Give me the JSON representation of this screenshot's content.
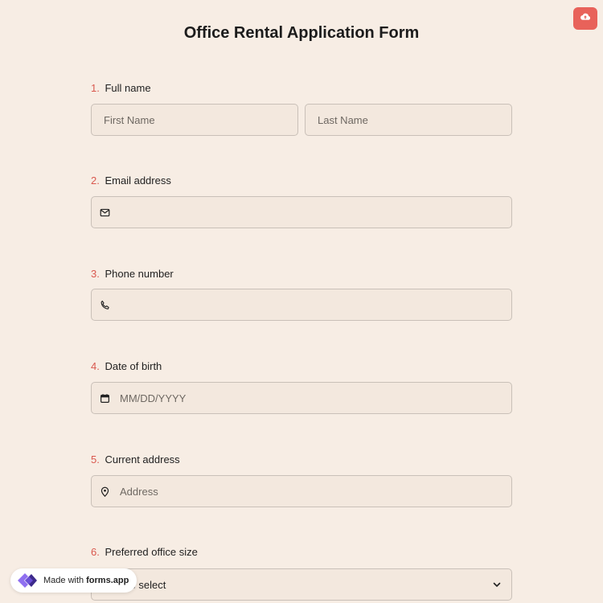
{
  "form": {
    "title": "Office Rental Application Form"
  },
  "questions": [
    {
      "num": "1.",
      "label": "Full name",
      "first_placeholder": "First Name",
      "last_placeholder": "Last Name"
    },
    {
      "num": "2.",
      "label": "Email address",
      "placeholder": ""
    },
    {
      "num": "3.",
      "label": "Phone number",
      "placeholder": ""
    },
    {
      "num": "4.",
      "label": "Date of birth",
      "placeholder": "MM/DD/YYYY"
    },
    {
      "num": "5.",
      "label": "Current address",
      "placeholder": "Address"
    },
    {
      "num": "6.",
      "label": "Preferred office size",
      "select_value": "Please select"
    }
  ],
  "badge": {
    "prefix": "Made with",
    "brand": "forms.app"
  },
  "colors": {
    "accent": "#e8625a",
    "number": "#d9584e",
    "background": "#f7ede4",
    "field_bg": "#f3e8de"
  },
  "icons": {
    "upload": "cloud-upload-icon",
    "email": "envelope-icon",
    "phone": "phone-icon",
    "date": "calendar-icon",
    "address": "map-pin-icon",
    "select": "chevron-down-icon"
  }
}
